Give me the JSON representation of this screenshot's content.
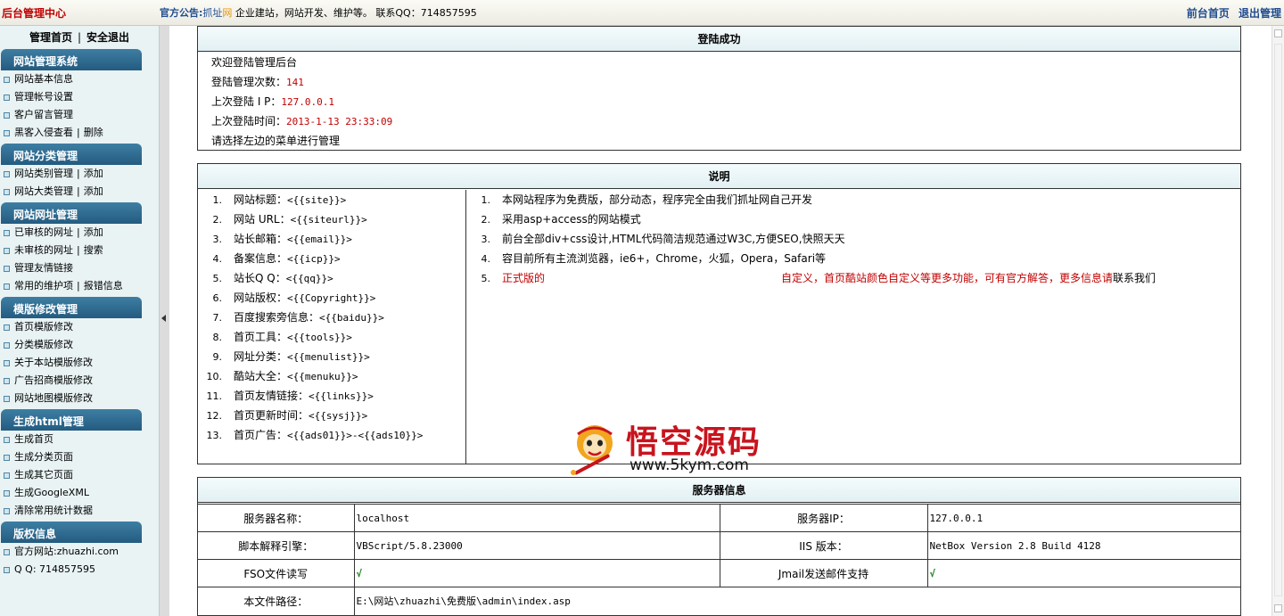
{
  "header": {
    "brand": "后台管理中心",
    "notice_label": "官方公告:",
    "notice_brand_a": "抓址",
    "notice_brand_b": "网",
    "notice_text": " 企业建站，网站开发、维护等。 联系QQ：714857595",
    "front_link": "前台首页",
    "logout_link": "退出管理"
  },
  "sidebar": {
    "home": "管理首页",
    "logout": "安全退出",
    "groups": [
      {
        "title": "网站管理系统",
        "items": [
          {
            "label": "网站基本信息"
          },
          {
            "label": "管理帐号设置"
          },
          {
            "label": "客户留言管理"
          },
          {
            "label": "黑客入侵查看",
            "extra": "删除"
          }
        ]
      },
      {
        "title": "网站分类管理",
        "items": [
          {
            "label": "网站类别管理",
            "extra": "添加"
          },
          {
            "label": "网站大类管理",
            "extra": "添加"
          }
        ]
      },
      {
        "title": "网站网址管理",
        "items": [
          {
            "label": "已审核的网址",
            "extra": "添加"
          },
          {
            "label": "未审核的网址",
            "extra": "搜索"
          },
          {
            "label": "管理友情链接"
          },
          {
            "label": "常用的维护项",
            "extra": "报错信息"
          }
        ]
      },
      {
        "title": "模版修改管理",
        "items": [
          {
            "label": "首页模版修改"
          },
          {
            "label": "分类模版修改"
          },
          {
            "label": "关于本站模版修改"
          },
          {
            "label": "广告招商模版修改"
          },
          {
            "label": "网站地图模版修改"
          }
        ]
      },
      {
        "title": "生成html管理",
        "items": [
          {
            "label": "生成首页"
          },
          {
            "label": "生成分类页面"
          },
          {
            "label": "生成其它页面"
          },
          {
            "label": "生成GoogleXML"
          },
          {
            "label": "清除常用统计数据"
          }
        ]
      },
      {
        "title": "版权信息",
        "items": [
          {
            "label": "官方网站:zhuazhi.com"
          },
          {
            "label": "Q Q: 714857595"
          }
        ]
      }
    ]
  },
  "login": {
    "title": "登陆成功",
    "welcome": "欢迎登陆管理后台",
    "count_label": "登陆管理次数：",
    "count_value": "141",
    "ip_label": "上次登陆 I P：",
    "ip_value": "127.0.0.1",
    "time_label": "上次登陆时间：",
    "time_value": "2013-1-13 23:33:09",
    "hint": "请选择左边的菜单进行管理"
  },
  "explain": {
    "title": "说明",
    "tags": [
      {
        "n": "1.",
        "label": "网站标题：",
        "tag": "<{{site}}>"
      },
      {
        "n": "2.",
        "label": "网站 URL：",
        "tag": "<{{siteurl}}>"
      },
      {
        "n": "3.",
        "label": "站长邮箱：",
        "tag": "<{{email}}>"
      },
      {
        "n": "4.",
        "label": "备案信息：",
        "tag": "<{{icp}}>"
      },
      {
        "n": "5.",
        "label": "站长Q Q：",
        "tag": "<{{qq}}>"
      },
      {
        "n": "6.",
        "label": "网站版权：",
        "tag": "<{{Copyright}}>"
      },
      {
        "n": "7.",
        "label": "百度搜索旁信息：",
        "tag": "<{{baidu}}>"
      },
      {
        "n": "8.",
        "label": "首页工具：",
        "tag": "<{{tools}}>"
      },
      {
        "n": "9.",
        "label": "网址分类：",
        "tag": "<{{menulist}}>"
      },
      {
        "n": "10.",
        "label": "酷站大全：",
        "tag": "<{{menuku}}>"
      },
      {
        "n": "11.",
        "label": "首页友情链接：",
        "tag": "<{{links}}>"
      },
      {
        "n": "12.",
        "label": "首页更新时间：",
        "tag": "<{{sysj}}>"
      },
      {
        "n": "13.",
        "label": "首页广告：",
        "tag": "<{{ads01}}>-<{{ads10}}>"
      }
    ],
    "notes": [
      {
        "n": "1.",
        "text": "本网站程序为免费版，部分动态，程序完全由我们抓址网自己开发"
      },
      {
        "n": "2.",
        "text": "采用asp+access的网站模式"
      },
      {
        "n": "3.",
        "text": "前台全部div+css设计,HTML代码简洁规范通过W3C,方便SEO,快照天天"
      },
      {
        "n": "4.",
        "text": "容目前所有主流浏览器，ie6+，Chrome，火狐，Opera，Safari等"
      },
      {
        "n": "5.",
        "text": "正式版的",
        "text_tail": "自定义，首页酷站颜色自定义等更多功能，可有官方解答，更多信息请",
        "text_end": "联系我们"
      }
    ]
  },
  "watermark": {
    "cn": "悟空源码",
    "url": "www.5kym.com"
  },
  "server": {
    "title": "服务器信息",
    "rows": [
      {
        "k1": "服务器名称：",
        "v1": "localhost",
        "k2": "服务器IP：",
        "v2": "127.0.0.1"
      },
      {
        "k1": "脚本解释引擎：",
        "v1": "VBScript/5.8.23000",
        "k2": "IIS 版本：",
        "v2": "NetBox Version 2.8 Build 4128"
      },
      {
        "k1": "FSO文件读写",
        "v1": "√",
        "k2": "Jmail发送邮件支持",
        "v2": "√"
      }
    ],
    "path_label": "本文件路径：",
    "path_value": "E:\\网站\\zhuazhi\\免费版\\admin\\index.asp"
  }
}
